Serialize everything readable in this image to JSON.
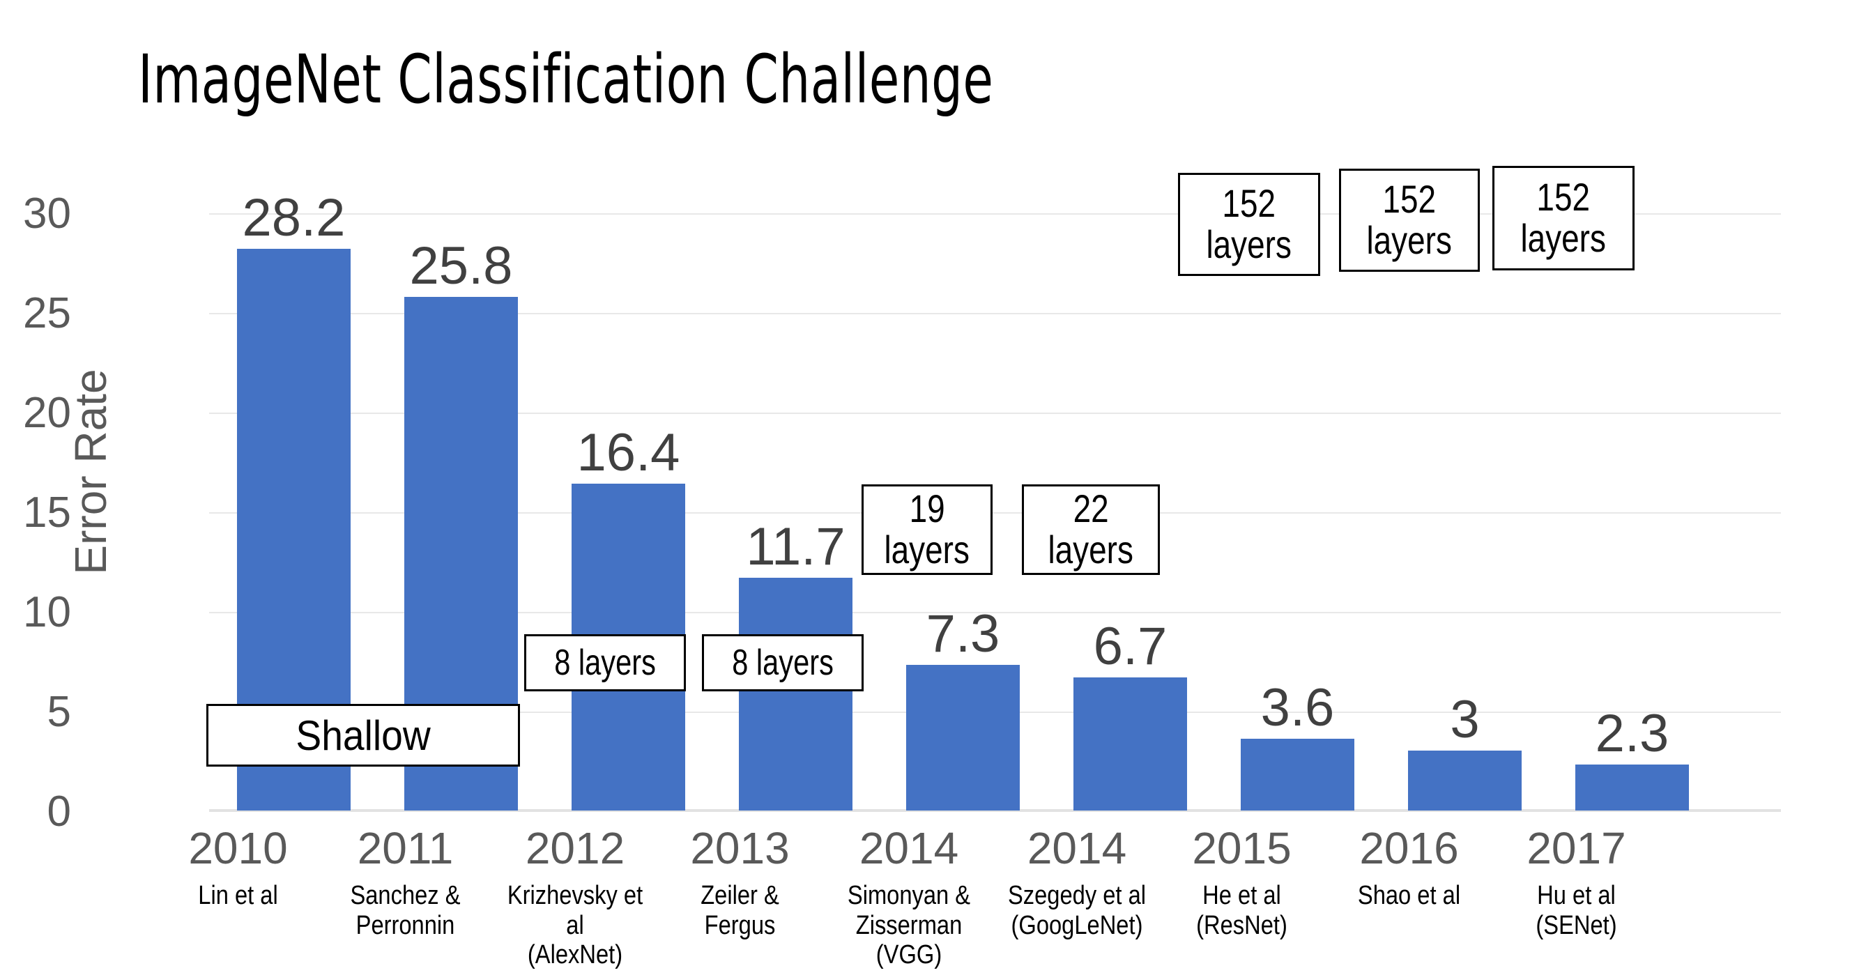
{
  "chart_data": {
    "type": "bar",
    "title": "ImageNet Classification Challenge",
    "xlabel": "",
    "ylabel": "Error Rate",
    "ylim": [
      0,
      30
    ],
    "yticks": [
      30,
      25,
      20,
      15,
      10,
      5,
      0
    ],
    "grid": true,
    "legend": "none",
    "bar_color": "#4472C4",
    "categories": [
      "2010",
      "2011",
      "2012",
      "2013",
      "2014",
      "2014",
      "2015",
      "2016",
      "2017"
    ],
    "values": [
      28.2,
      25.8,
      16.4,
      11.7,
      7.3,
      6.7,
      3.6,
      3,
      2.3
    ],
    "value_labels": [
      "28.2",
      "25.8",
      "16.4",
      "11.7",
      "7.3",
      "6.7",
      "3.6",
      "3",
      "2.3"
    ],
    "authors": [
      "Lin et al",
      "Sanchez &\nPerronnin",
      "Krizhevsky et al\n(AlexNet)",
      "Zeiler &\nFergus",
      "Simonyan &\nZisserman (VGG)",
      "Szegedy et al\n(GoogLeNet)",
      "He et al\n(ResNet)",
      "Shao et al",
      "Hu et al\n(SENet)"
    ],
    "annotations": [
      {
        "text": "Shallow",
        "kind": "shallow",
        "spans_categories": [
          "2010",
          "2011"
        ]
      },
      {
        "text": "8 layers",
        "kind": "depth",
        "category": "2012"
      },
      {
        "text": "8 layers",
        "kind": "depth",
        "category": "2013"
      },
      {
        "text": "19\nlayers",
        "kind": "depth",
        "category": "2014-vgg"
      },
      {
        "text": "22\nlayers",
        "kind": "depth",
        "category": "2014-googlenet"
      },
      {
        "text": "152\nlayers",
        "kind": "depth",
        "category": "2015"
      },
      {
        "text": "152\nlayers",
        "kind": "depth",
        "category": "2016"
      },
      {
        "text": "152\nlayers",
        "kind": "depth",
        "category": "2017"
      }
    ]
  },
  "title": "ImageNet Classification Challenge",
  "axis": {
    "y_title": "Error Rate",
    "y_ticks": {
      "t30": "30",
      "t25": "25",
      "t20": "20",
      "t15": "15",
      "t10": "10",
      "t5": "5",
      "t0": "0"
    }
  },
  "bars": [
    {
      "year": "2010",
      "value": "28.2",
      "author_line1": "Lin et al",
      "author_line2": ""
    },
    {
      "year": "2011",
      "value": "25.8",
      "author_line1": "Sanchez &",
      "author_line2": "Perronnin"
    },
    {
      "year": "2012",
      "value": "16.4",
      "author_line1": "Krizhevsky et al",
      "author_line2": "(AlexNet)"
    },
    {
      "year": "2013",
      "value": "11.7",
      "author_line1": "Zeiler &",
      "author_line2": "Fergus"
    },
    {
      "year": "2014",
      "value": "7.3",
      "author_line1": "Simonyan &",
      "author_line2": "Zisserman (VGG)"
    },
    {
      "year": "2014",
      "value": "6.7",
      "author_line1": "Szegedy et al",
      "author_line2": "(GoogLeNet)"
    },
    {
      "year": "2015",
      "value": "3.6",
      "author_line1": "He et al",
      "author_line2": "(ResNet)"
    },
    {
      "year": "2016",
      "value": "3",
      "author_line1": "Shao et al",
      "author_line2": ""
    },
    {
      "year": "2017",
      "value": "2.3",
      "author_line1": "Hu et al",
      "author_line2": "(SENet)"
    }
  ],
  "callouts": {
    "shallow": "Shallow",
    "alexnet_layers": "8 layers",
    "zf_layers": "8 layers",
    "vgg_num": "19",
    "vgg_word": "layers",
    "googlenet_num": "22",
    "googlenet_word": "layers",
    "resnet_num": "152",
    "resnet_word": "layers",
    "shao_num": "152",
    "shao_word": "layers",
    "senet_num": "152",
    "senet_word": "layers"
  }
}
